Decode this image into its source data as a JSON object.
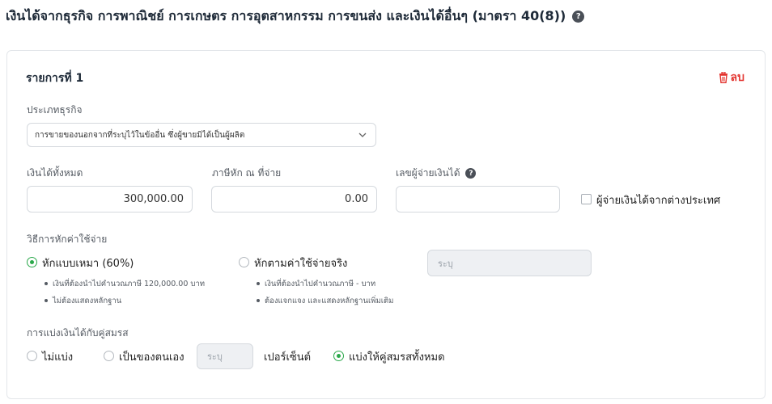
{
  "page": {
    "title": "เงินได้จากธุรกิจ การพาณิชย์ การเกษตร การอุตสาหกรรม การขนส่ง และเงินได้อื่นๆ (มาตรา 40(8))",
    "help_icon": "question-icon"
  },
  "item": {
    "title": "รายการที่ 1",
    "delete_label": "ลบ",
    "delete_icon": "trash-icon"
  },
  "business_type": {
    "label": "ประเภทธุรกิจ",
    "selected": "การขายของนอกจากที่ระบุไว้ในข้ออื่น ซึ่งผู้ขายมิได้เป็นผู้ผลิต"
  },
  "total_income": {
    "label": "เงินได้ทั้งหมด",
    "value": "300,000.00"
  },
  "withholding_tax": {
    "label": "ภาษีหัก ณ ที่จ่าย",
    "value": "0.00"
  },
  "payer_id": {
    "label": "เลขผู้จ่ายเงินได้",
    "value": ""
  },
  "foreign_payer": {
    "label": "ผู้จ่ายเงินได้จากต่างประเทศ",
    "checked": false
  },
  "expense_method": {
    "label": "วิธีการหักค่าใช้จ่าย",
    "flat": {
      "label": "หักแบบเหมา (60%)",
      "selected": true,
      "notes": [
        "เงินที่ต้องนำไปคำนวณภาษี 120,000.00 บาท",
        "ไม่ต้องแสดงหลักฐาน"
      ]
    },
    "actual": {
      "label": "หักตามค่าใช้จ่ายจริง",
      "selected": false,
      "notes": [
        "เงินที่ต้องนำไปคำนวณภาษี - บาท",
        "ต้องแจกแจง และแสดงหลักฐานเพิ่มเติม"
      ],
      "placeholder": "ระบุ"
    }
  },
  "spouse_split": {
    "label": "การแบ่งเงินได้กับคู่สมรส",
    "none_label": "ไม่แบ่ง",
    "own_label": "เป็นของตนเอง",
    "own_placeholder": "ระบุ",
    "percent_label": "เปอร์เซ็นต์",
    "all_label": "แบ่งให้คู่สมรสทั้งหมด",
    "selected": "all"
  },
  "colors": {
    "accent_green": "#2aa84a",
    "delete_red": "#e3342f"
  }
}
